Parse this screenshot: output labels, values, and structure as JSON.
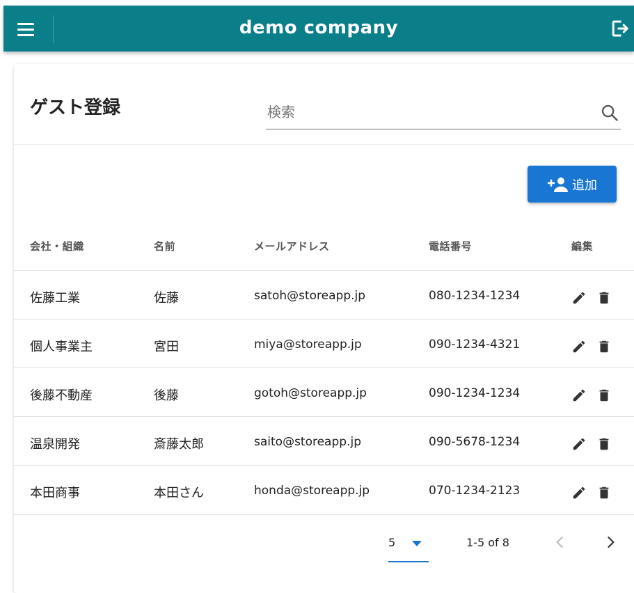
{
  "app": {
    "title": "demo company"
  },
  "page": {
    "title": "ゲスト登録",
    "search_placeholder": "検索",
    "add_label": "追加"
  },
  "table": {
    "headers": [
      "会社・組織",
      "名前",
      "メールアドレス",
      "電話番号",
      "編集"
    ],
    "rows": [
      {
        "company": "佐藤工業",
        "name": "佐藤",
        "email": "satoh@storeapp.jp",
        "phone": "080-1234-1234"
      },
      {
        "company": "個人事業主",
        "name": "宮田",
        "email": "miya@storeapp.jp",
        "phone": "090-1234-4321"
      },
      {
        "company": "後藤不動産",
        "name": "後藤",
        "email": "gotoh@storeapp.jp",
        "phone": "090-1234-1234"
      },
      {
        "company": "温泉開発",
        "name": "斎藤太郎",
        "email": "saito@storeapp.jp",
        "phone": "090-5678-1234"
      },
      {
        "company": "本田商事",
        "name": "本田さん",
        "email": "honda@storeapp.jp",
        "phone": "070-1234-2123"
      }
    ]
  },
  "pagination": {
    "rows_per_page": "5",
    "range": "1-5 of 8"
  },
  "icons": {
    "menu": "menu-icon",
    "logout": "logout-icon",
    "search": "search-icon",
    "add_user": "add-user-icon",
    "edit": "pencil-icon",
    "delete": "trash-icon",
    "prev": "chevron-left-icon",
    "next": "chevron-right-icon"
  },
  "colors": {
    "appbar": "#0a7f89",
    "primary": "#1976d2"
  }
}
